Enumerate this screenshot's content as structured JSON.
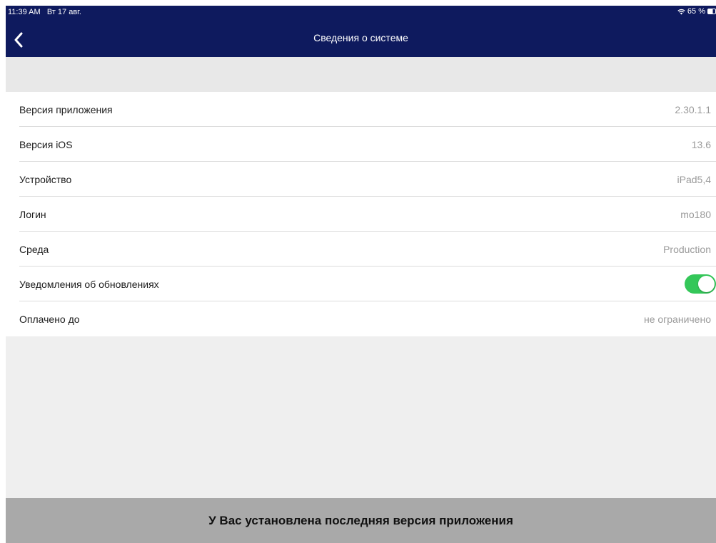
{
  "status_bar": {
    "time": "11:39 AM",
    "date": "Вт 17 авг.",
    "battery": "65 %",
    "battery_level": 0.65,
    "icons": [
      "wifi-icon",
      "battery-icon"
    ]
  },
  "nav": {
    "title": "Сведения о системе",
    "back_icon": "chevron-left-icon"
  },
  "rows": [
    {
      "label": "Версия приложения",
      "value": "2.30.1.1"
    },
    {
      "label": "Версия iOS",
      "value": "13.6"
    },
    {
      "label": "Устройство",
      "value": "iPad5,4"
    },
    {
      "label": "Логин",
      "value": "mo180"
    },
    {
      "label": "Среда",
      "value": "Production"
    },
    {
      "label": "Уведомления об обновлениях",
      "toggle": true
    },
    {
      "label": "Оплачено до",
      "value": "не ограничено"
    }
  ],
  "banner": {
    "text": "У Вас установлена последняя версия приложения"
  },
  "colors": {
    "navbar": "#0e1a5e",
    "toggle_on": "#34c759",
    "banner": "#a9a9a9",
    "background": "#efefef"
  }
}
